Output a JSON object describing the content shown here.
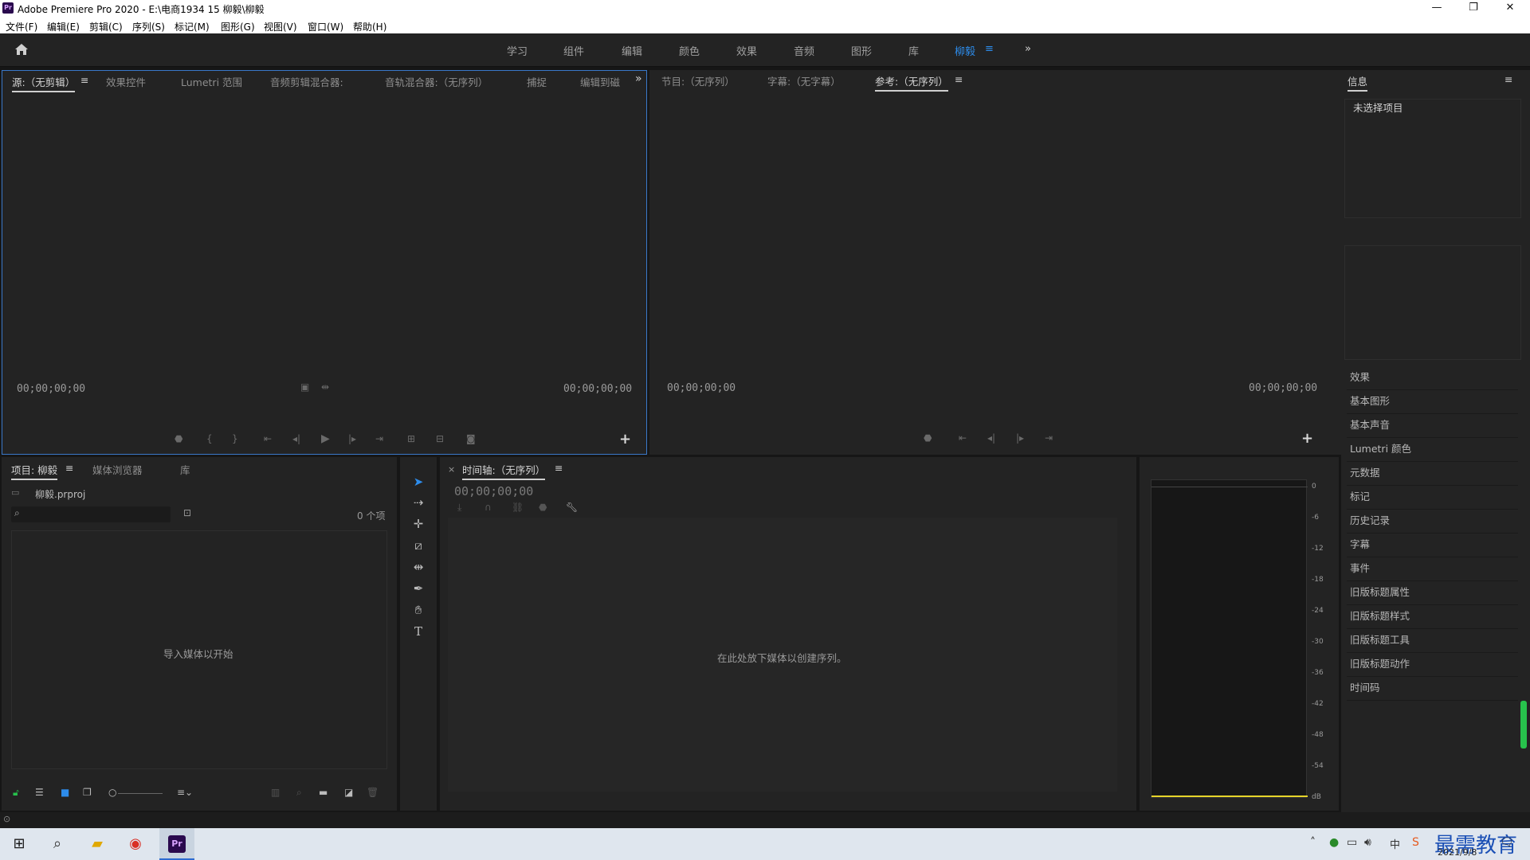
{
  "window": {
    "app_icon_text": "Pr",
    "title": "Adobe Premiere Pro 2020 - E:\\电商1934 15 柳毅\\柳毅",
    "minimize": "—",
    "restore": "❐",
    "close": "✕"
  },
  "menu": [
    "文件(F)",
    "编辑(E)",
    "剪辑(C)",
    "序列(S)",
    "标记(M)",
    "图形(G)",
    "视图(V)",
    "窗口(W)",
    "帮助(H)"
  ],
  "workspaces": {
    "items": [
      "学习",
      "组件",
      "编辑",
      "颜色",
      "效果",
      "音频",
      "图形",
      "库",
      "柳毅"
    ],
    "active": "柳毅",
    "menu_glyph": "≡",
    "overflow_glyph": "»"
  },
  "source_panel": {
    "tabs": [
      "源:（无剪辑）",
      "效果控件",
      "Lumetri 范围",
      "音频剪辑混合器:",
      "音轨混合器:（无序列）",
      "捕捉",
      "编辑到磁"
    ],
    "menu_glyph": "≡",
    "overflow_glyph": "»",
    "timecode_left": "00;00;00;00",
    "timecode_right": "00;00;00;00",
    "plus": "+"
  },
  "program_panel": {
    "tabs": [
      "节目:（无序列）",
      "字幕:（无字幕）",
      "参考:（无序列）"
    ],
    "menu_glyph": "≡",
    "timecode_left": "00;00;00;00",
    "timecode_right": "00;00;00;00",
    "plus": "+"
  },
  "info_panel": {
    "title": "信息",
    "menu_glyph": "≡",
    "text": "未选择项目"
  },
  "side_panels": [
    "效果",
    "基本图形",
    "基本声音",
    "Lumetri 颜色",
    "元数据",
    "标记",
    "历史记录",
    "字幕",
    "事件",
    "旧版标题属性",
    "旧版标题样式",
    "旧版标题工具",
    "旧版标题动作",
    "时间码"
  ],
  "project_panel": {
    "tabs": [
      "项目: 柳毅",
      "媒体浏览器",
      "库"
    ],
    "menu_glyph": "≡",
    "file": "柳毅.prproj",
    "search_placeholder": "",
    "item_count": "0 个项",
    "empty_text": "导入媒体以开始"
  },
  "timeline_panel": {
    "close_glyph": "×",
    "title": "时间轴:（无序列）",
    "menu_glyph": "≡",
    "timecode": "00;00;00;00",
    "empty_text": "在此处放下媒体以创建序列。"
  },
  "audio_meter": {
    "ticks": [
      "0",
      "-6",
      "-12",
      "-18",
      "-24",
      "-30",
      "-36",
      "-42",
      "-48",
      "-54",
      "dB"
    ]
  },
  "taskbar": {
    "date": "2021/9/8",
    "ime": "中",
    "watermark": "最需教育"
  },
  "colors": {
    "accent": "#2d8ceb",
    "panel_bg": "#232323",
    "active_border": "#3a78c9",
    "meter_green": "#27c24c"
  }
}
